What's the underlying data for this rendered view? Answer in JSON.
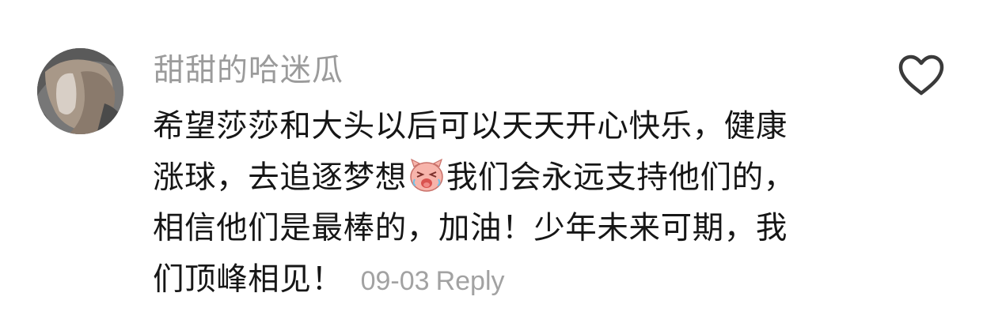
{
  "comment": {
    "username": "甜甜的哈迷瓜",
    "avatar_icon": "user-avatar-photo",
    "like_icon": "heart-outline-icon",
    "text": {
      "line1": "希望莎莎和大头以后可以天天开心快乐，健康",
      "line2_a": "涨球，去追逐梦想",
      "line2_b": "我们会永远支持他们的，",
      "line3": "相信他们是最棒的，加油！少年未来可期，我",
      "line4": "们顶峰相见！"
    },
    "emoji_icon": "crying-pig-face-emoji",
    "date": "09-03",
    "reply_label": "Reply",
    "colors": {
      "username": "#9b9b9b",
      "text": "#161616",
      "meta": "#a2a2a2",
      "emoji": "#f7b4ab"
    }
  }
}
